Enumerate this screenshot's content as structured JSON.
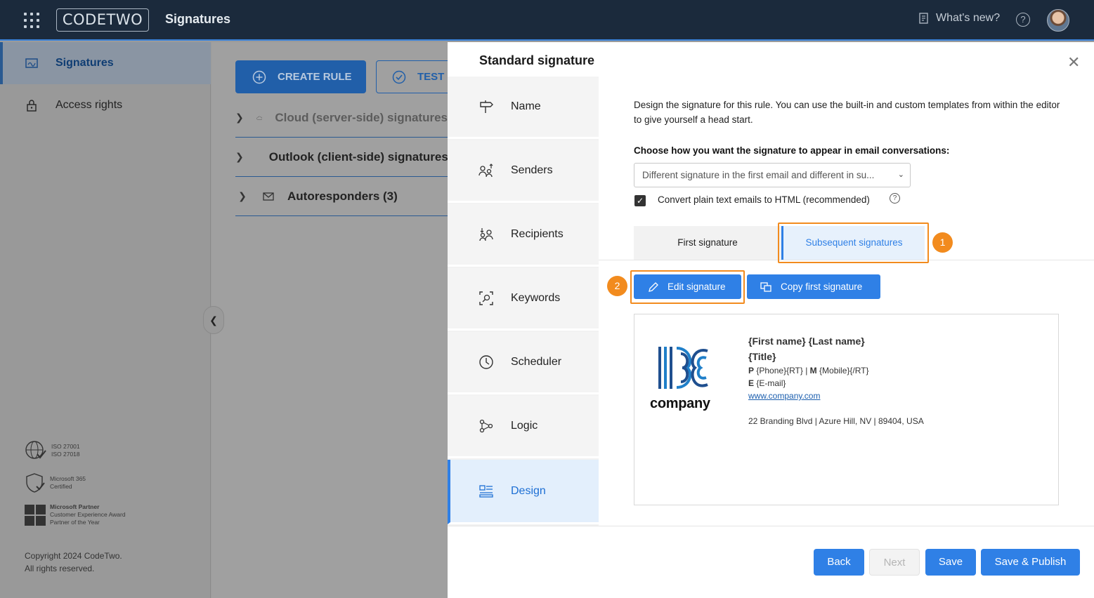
{
  "topbar": {
    "logo_text": "CODETWO",
    "app_title": "Signatures",
    "whats_new": "What's new?",
    "help_glyph": "?"
  },
  "leftnav": {
    "items": [
      {
        "label": "Signatures",
        "icon": "signatures-icon",
        "active": true
      },
      {
        "label": "Access rights",
        "icon": "lock-icon",
        "active": false
      }
    ],
    "certs": [
      {
        "lines": [
          "ISO 27001",
          "ISO 27018"
        ],
        "icon": "globe-check-icon"
      },
      {
        "lines": [
          "Microsoft 365",
          "Certified"
        ],
        "icon": "shield-check-icon"
      },
      {
        "lines": [
          "Microsoft Partner",
          "Customer Experience Award",
          "Partner of the Year"
        ],
        "icon": "microsoft-logo-icon"
      }
    ],
    "copyright_line1": "Copyright 2024 CodeTwo.",
    "copyright_line2": "All rights reserved."
  },
  "main": {
    "create_rule": "CREATE RULE",
    "test": "TEST",
    "rules": [
      {
        "label": "Cloud (server-side) signatures",
        "icon": "cloud-icon"
      },
      {
        "label": "Outlook (client-side) signatures",
        "icon": "monitor-icon"
      },
      {
        "label": "Autoresponders (3)",
        "icon": "mail-icon"
      }
    ]
  },
  "panel": {
    "title": "Standard signature",
    "steps": [
      {
        "label": "Name",
        "icon": "signpost-icon"
      },
      {
        "label": "Senders",
        "icon": "senders-icon"
      },
      {
        "label": "Recipients",
        "icon": "recipients-icon"
      },
      {
        "label": "Keywords",
        "icon": "keywords-icon"
      },
      {
        "label": "Scheduler",
        "icon": "clock-icon"
      },
      {
        "label": "Logic",
        "icon": "logic-icon"
      },
      {
        "label": "Design",
        "icon": "design-icon"
      }
    ],
    "description": "Design the signature for this rule. You can use the built-in and custom templates from within the editor to give yourself a head start.",
    "choose_label": "Choose how you want the signature to appear in email conversations:",
    "select_value": "Different signature in the first email and different in su...",
    "convert_label": "Convert plain text emails to HTML (recommended)",
    "tabs": {
      "first": "First signature",
      "subsequent": "Subsequent signatures"
    },
    "badge1": "1",
    "badge2": "2",
    "edit_signature": "Edit signature",
    "copy_first_signature": "Copy first signature",
    "signature": {
      "company": "company",
      "name": "{First name} {Last name}",
      "title": "{Title}",
      "phone_label": "P",
      "phone_value": "{Phone}{RT}",
      "mobile_label": "M",
      "mobile_value": "{Mobile}{/RT}",
      "email_label": "E",
      "email_value": "{E-mail}",
      "website": "www.company.com",
      "address": "22 Branding Blvd | Azure Hill, NV | 89404, USA"
    },
    "footer": {
      "back": "Back",
      "next": "Next",
      "save": "Save",
      "save_publish": "Save & Publish"
    }
  },
  "colors": {
    "accent": "#2f80e6",
    "highlight": "#f28b1e",
    "topbar": "#1b2a3c"
  }
}
